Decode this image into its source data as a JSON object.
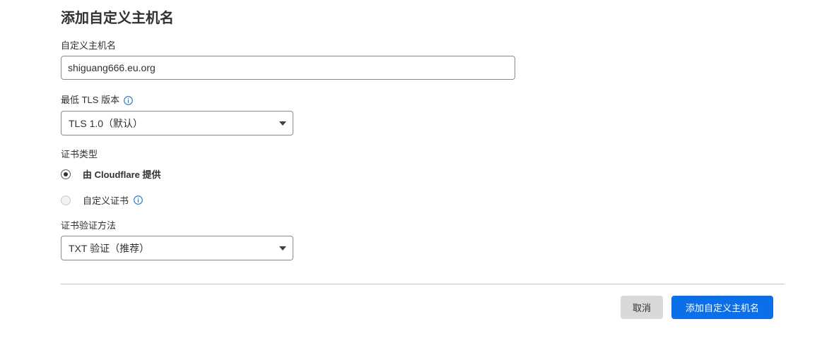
{
  "form": {
    "title": "添加自定义主机名",
    "hostname": {
      "label": "自定义主机名",
      "value": "shiguang666.eu.org"
    },
    "tls": {
      "label": "最低 TLS 版本",
      "selected": "TLS 1.0（默认）"
    },
    "cert_type": {
      "label": "证书类型",
      "options": [
        {
          "label": "由 Cloudflare 提供",
          "checked": true
        },
        {
          "label": "自定义证书",
          "checked": false
        }
      ]
    },
    "validation": {
      "label": "证书验证方法",
      "selected": "TXT 验证（推荐）"
    }
  },
  "actions": {
    "cancel_label": "取消",
    "submit_label": "添加自定义主机名"
  },
  "colors": {
    "primary": "#0a6fe8",
    "info_icon": "#1a73c8",
    "cancel_bg": "#d9d9d9"
  },
  "icons": {
    "info": "info-icon",
    "dropdown": "chevron-down-icon"
  }
}
